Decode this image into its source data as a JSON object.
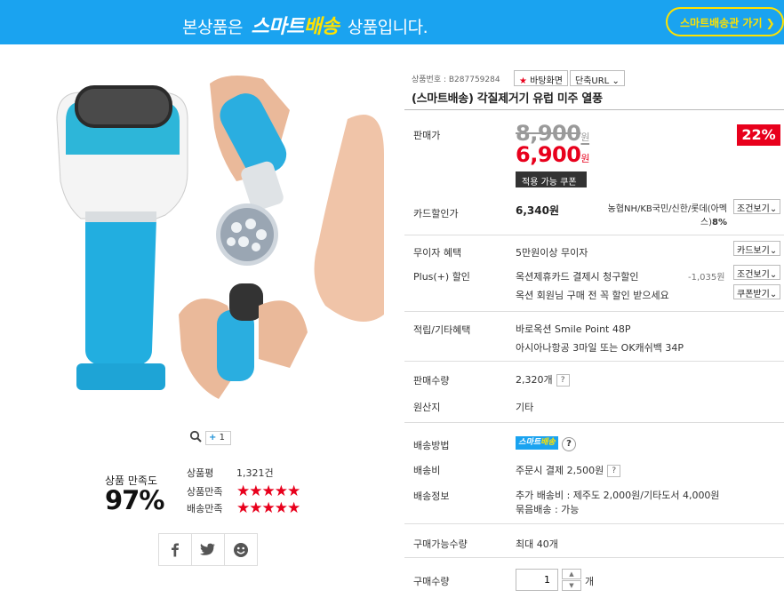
{
  "banner": {
    "prefix": "본상품은",
    "brand_white": "스마트",
    "brand_yellow": "배송",
    "suffix": "상품입니다.",
    "cta": "스마트배송관 가기 ❯"
  },
  "image_tools": {
    "plus_count": "1"
  },
  "satisfaction": {
    "label": "상품 만족도",
    "value": "97%",
    "review_label": "상품평",
    "review_count": "1,321건",
    "product_label": "상품만족",
    "product_rating": 5,
    "delivery_label": "배송만족",
    "delivery_rating": 5
  },
  "share": [
    "facebook-icon",
    "twitter-icon",
    "smile-icon"
  ],
  "product": {
    "number": "상품번호 : B287759284",
    "desktop_btn": "바탕화면",
    "short_url_btn": "단축URL",
    "title": "(스마트배송) 각질제거기 유럽 미주 열풍"
  },
  "price": {
    "label": "판매가",
    "original": "8,900",
    "sale": "6,900",
    "unit": "원",
    "discount": "22%",
    "coupon_btn": "적용 가능 쿠폰"
  },
  "card": {
    "label": "카드할인가",
    "price": "6,340원",
    "banks": "농협NH/KB국민/신한/롯데(아멕스)",
    "rate": "8%",
    "btn": "조건보기"
  },
  "free_interest": {
    "label": "무이자 혜택",
    "value": "5만원이상 무이자",
    "btn": "카드보기"
  },
  "plus_discount": {
    "label": "Plus(+) 할인",
    "line1": "옥션제휴카드 결제시 청구할인",
    "line1_amount": "-1,035원",
    "line1_btn": "조건보기",
    "line2": "옥션 회원님 구매 전 꼭 할인 받으세요",
    "line2_btn": "쿠폰받기"
  },
  "points": {
    "label": "적립/기타혜택",
    "line1": "바로옥션 Smile Point 48P",
    "line2": "아시아나항공 3마일 또는 OK캐쉬백 34P"
  },
  "sales": {
    "label": "판매수량",
    "value": "2,320개",
    "origin_label": "원산지",
    "origin_value": "기타"
  },
  "shipping": {
    "method_label": "배송방법",
    "badge_white": "스마트",
    "badge_yellow": "배송",
    "fee_label": "배송비",
    "fee_value": "주문시 결제 2,500원",
    "info_label": "배송정보",
    "info_line1": "추가 배송비 : 제주도 2,000원/기타도서 4,000원",
    "info_line2": "묶음배송 : 가능"
  },
  "limits": {
    "label": "구매가능수량",
    "value": "최대 40개"
  },
  "quantity": {
    "label": "구매수량",
    "value": "1",
    "unit": "개"
  },
  "colors": {
    "brand_blue": "#1aa3f0",
    "yellow": "#ffe200",
    "sale_red": "#e8001c"
  }
}
